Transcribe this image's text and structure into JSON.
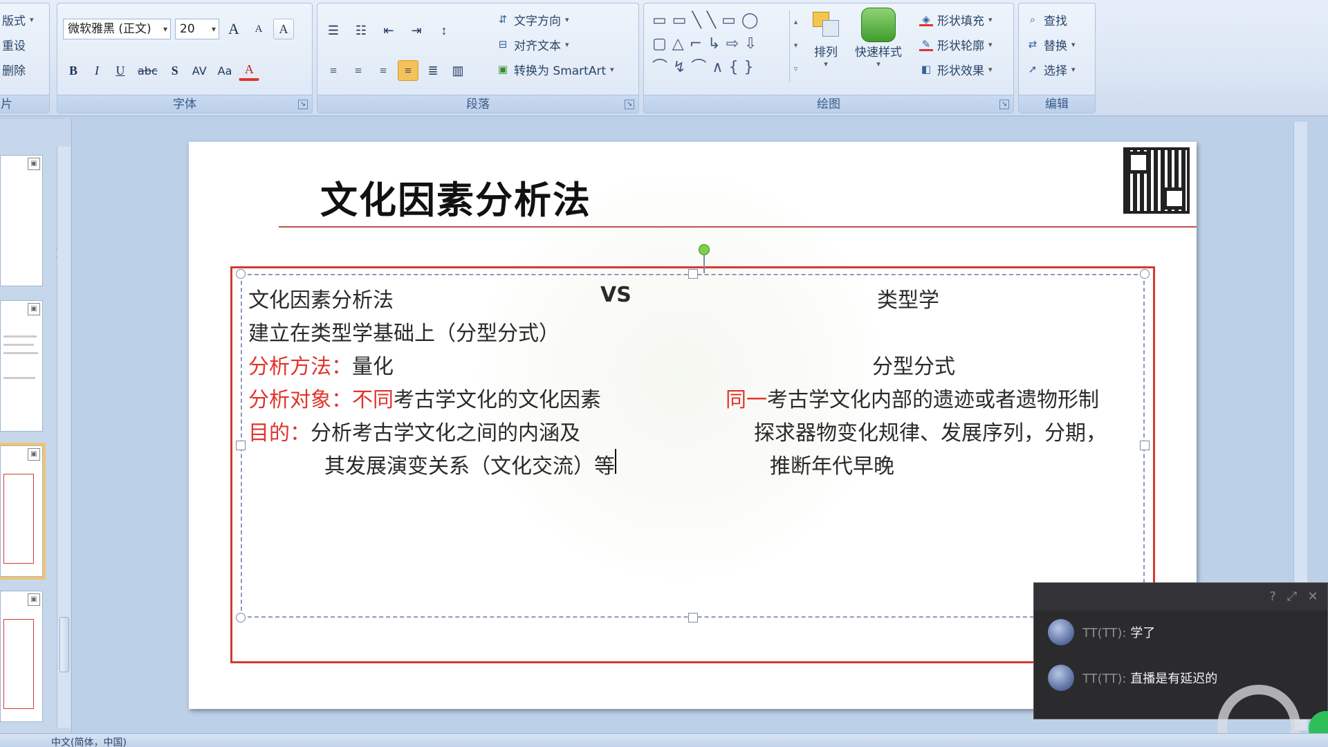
{
  "ribbon": {
    "slides_group": {
      "layout": "版式",
      "reset": "重设",
      "delete": "删除",
      "label": "片"
    },
    "font_group": {
      "font_name": "微软雅黑 (正文)",
      "font_size": "20",
      "grow": "A",
      "shrink": "A",
      "clear": "A",
      "bold": "B",
      "italic": "I",
      "underline": "U",
      "strike": "abc",
      "shadow": "S",
      "spacing": "AV",
      "case": "Aa",
      "color": "A",
      "label": "字体"
    },
    "paragraph_group": {
      "text_direction": "文字方向",
      "align_text": "对齐文本",
      "smartart": "转换为 SmartArt",
      "label": "段落"
    },
    "drawing_group": {
      "arrange": "排列",
      "quick_styles": "快速样式",
      "shape_fill": "形状填充",
      "shape_outline": "形状轮廓",
      "shape_effects": "形状效果",
      "label": "绘图"
    },
    "editing_group": {
      "find": "查找",
      "replace": "替换",
      "select": "选择",
      "label": "编辑"
    }
  },
  "slide": {
    "title": "文化因素分析法",
    "row1_left": "文化因素分析法",
    "row1_vs": "VS",
    "row1_right": "类型学",
    "row2": "建立在类型学基础上（分型分式）",
    "row3_label": "分析方法：",
    "row3_value": "量化",
    "row3_right": "分型分式",
    "row4_label": "分析对象：",
    "row4_label2": "不同",
    "row4_value": "考古学文化的文化因素",
    "row4_right_red": "同一",
    "row4_right": "考古学文化内部的遗迹或者遗物形制",
    "row5_label": "目的：",
    "row5_value": "分析考古学文化之间的内涵及",
    "row5_right": "探求器物变化规律、发展序列，分期，",
    "row6_value": "其发展演变关系（文化交流）",
    "row6_tail": "等",
    "row6_right": "推断年代早晚"
  },
  "chat": {
    "messages": [
      {
        "name": "TT(TT):",
        "body": "学了"
      },
      {
        "name": "TT(TT):",
        "body": "直播是有延迟的"
      }
    ]
  },
  "statusbar": {
    "language": "中文(简体，中国)"
  },
  "colors": {
    "accent_red": "#e0342c",
    "frame_red": "#d23a33",
    "ribbon_blue": "#3b5a85"
  }
}
